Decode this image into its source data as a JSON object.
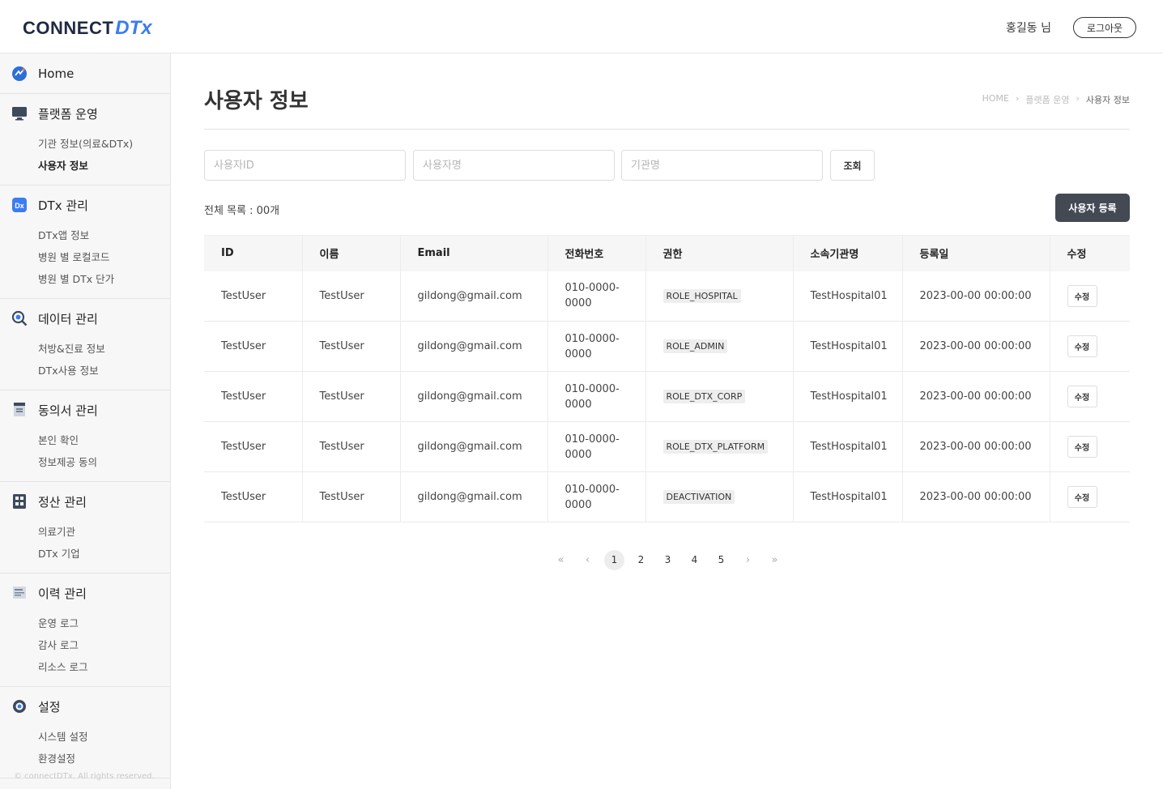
{
  "header": {
    "logo_text": "CONNECT",
    "logo_dtx": "DTx",
    "user_name": "홍길동 님",
    "logout_label": "로그아웃"
  },
  "sidebar": {
    "home_label": "Home",
    "sections": [
      {
        "label": "플랫폼 운영",
        "icon": "monitor-icon",
        "items": [
          "기관 정보(의료&DTx)",
          "사용자 정보"
        ]
      },
      {
        "label": "DTx 관리",
        "icon": "dtx-icon",
        "items": [
          "DTx앱 정보",
          "병원 별 로컬코드",
          "병원 별 DTx 단가"
        ]
      },
      {
        "label": "데이터 관리",
        "icon": "search-data-icon",
        "items": [
          "처방&진료 정보",
          "DTx사용 정보"
        ]
      },
      {
        "label": "동의서 관리",
        "icon": "document-icon",
        "items": [
          "본인 확인",
          "정보제공 동의"
        ]
      },
      {
        "label": "정산 관리",
        "icon": "calculator-icon",
        "items": [
          "의료기관",
          "DTx 기업"
        ]
      },
      {
        "label": "이력 관리",
        "icon": "log-icon",
        "items": [
          "운영 로그",
          "감사 로그",
          "리소스 로그"
        ]
      },
      {
        "label": "설정",
        "icon": "gear-icon",
        "items": [
          "시스템 설정",
          "환경설정"
        ]
      }
    ],
    "copyright": "© connectDTx. All rights reserved."
  },
  "main": {
    "title": "사용자 정보",
    "breadcrumb": [
      "HOME",
      "플랫폼 운영",
      "사용자 정보"
    ],
    "search": {
      "user_id_placeholder": "사용자ID",
      "user_name_placeholder": "사용자명",
      "org_name_placeholder": "기관명",
      "search_label": "조회"
    },
    "total_label": "전체 목록 : 00개",
    "add_user_label": "사용자 등록",
    "table": {
      "columns": [
        "ID",
        "이름",
        "Email",
        "전화번호",
        "권한",
        "소속기관명",
        "등록일",
        "수정"
      ],
      "rows": [
        {
          "id": "TestUser",
          "name": "TestUser",
          "email": "gildong@gmail.com",
          "phone": "010-0000-0000",
          "role": "ROLE_HOSPITAL",
          "org": "TestHospital01",
          "date": "2023-00-00 00:00:00",
          "edit": "수정"
        },
        {
          "id": "TestUser",
          "name": "TestUser",
          "email": "gildong@gmail.com",
          "phone": "010-0000-0000",
          "role": "ROLE_ADMIN",
          "org": "TestHospital01",
          "date": "2023-00-00 00:00:00",
          "edit": "수정"
        },
        {
          "id": "TestUser",
          "name": "TestUser",
          "email": "gildong@gmail.com",
          "phone": "010-0000-0000",
          "role": "ROLE_DTX_CORP",
          "org": "TestHospital01",
          "date": "2023-00-00 00:00:00",
          "edit": "수정"
        },
        {
          "id": "TestUser",
          "name": "TestUser",
          "email": "gildong@gmail.com",
          "phone": "010-0000-0000",
          "role": "ROLE_DTX_PLATFORM",
          "org": "TestHospital01",
          "date": "2023-00-00 00:00:00",
          "edit": "수정"
        },
        {
          "id": "TestUser",
          "name": "TestUser",
          "email": "gildong@gmail.com",
          "phone": "010-0000-0000",
          "role": "DEACTIVATION",
          "org": "TestHospital01",
          "date": "2023-00-00 00:00:00",
          "edit": "수정"
        }
      ]
    },
    "pagination": {
      "pages": [
        "1",
        "2",
        "3",
        "4",
        "5"
      ],
      "current": "1"
    }
  }
}
